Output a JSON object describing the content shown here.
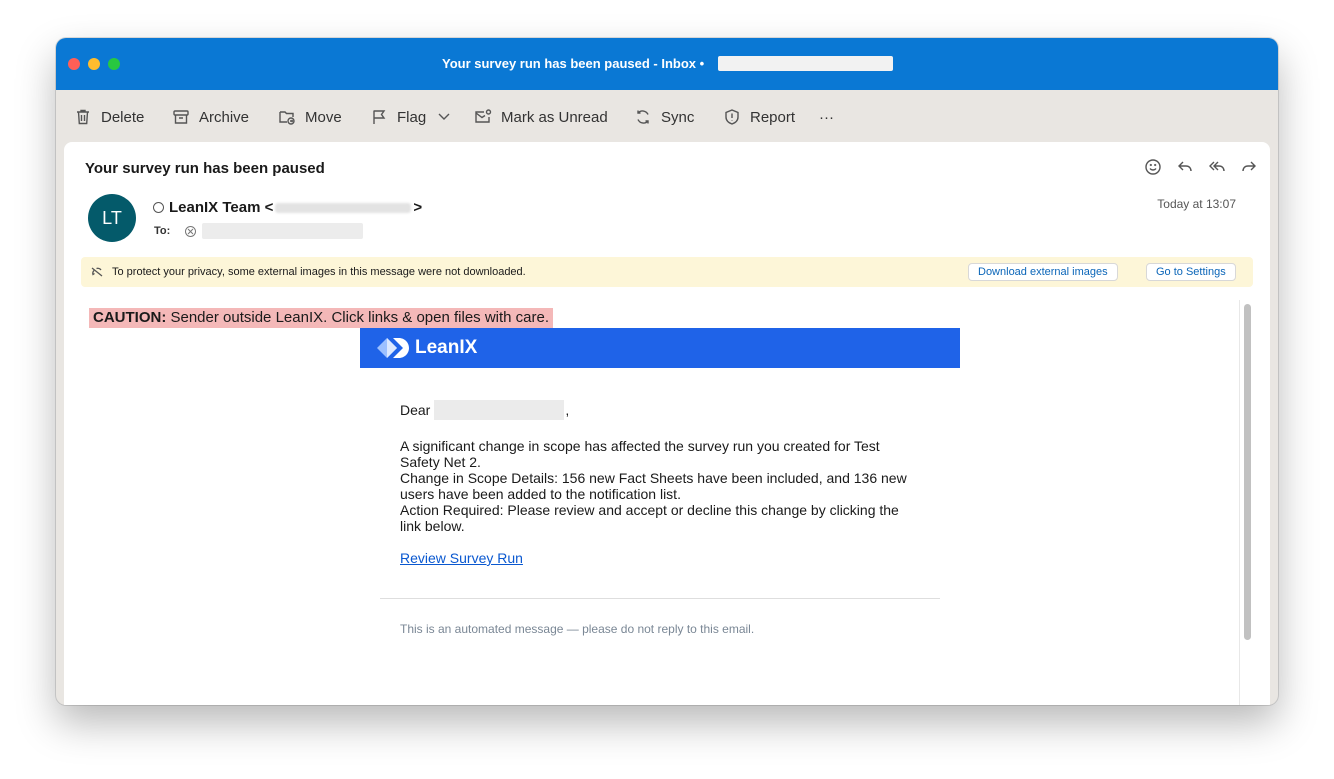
{
  "window": {
    "title": "Your survey run has been paused - Inbox •"
  },
  "toolbar": {
    "delete": "Delete",
    "archive": "Archive",
    "move": "Move",
    "flag": "Flag",
    "mark_unread": "Mark as Unread",
    "sync": "Sync",
    "report": "Report",
    "more": "···"
  },
  "message": {
    "subject": "Your survey run has been paused",
    "avatar_initials": "LT",
    "sender_name": "LeanIX Team <",
    "sender_close": ">",
    "to_label": "To:",
    "date": "Today at 13:07"
  },
  "privacy": {
    "text": "To protect your privacy, some external images in this message were not downloaded.",
    "download_button": "Download external images",
    "settings_button": "Go to Settings"
  },
  "body": {
    "caution_label": "CAUTION:",
    "caution_text": " Sender outside LeanIX. Click links & open files with care.",
    "logo_text": "LeanIX",
    "greeting": "Dear",
    "greeting_comma": ",",
    "paragraph_1": "A significant change in scope has affected the survey run you created for Test Safety Net 2.",
    "paragraph_2": "Change in Scope Details: 156 new Fact Sheets have been included, and 136 new users have been added to the notification list.",
    "paragraph_3": "Action Required: Please review and accept or decline this change by clicking the link below.",
    "link_text": "Review Survey Run",
    "footer": "This is an automated message — please do not reply to this email."
  },
  "colors": {
    "titlebar": "#0a78d4",
    "banner": "#1f63e8",
    "caution_bg": "#f4b8b8",
    "privacy_bg": "#fdf6d8",
    "avatar_bg": "#045a6a",
    "link": "#0a58d0"
  }
}
